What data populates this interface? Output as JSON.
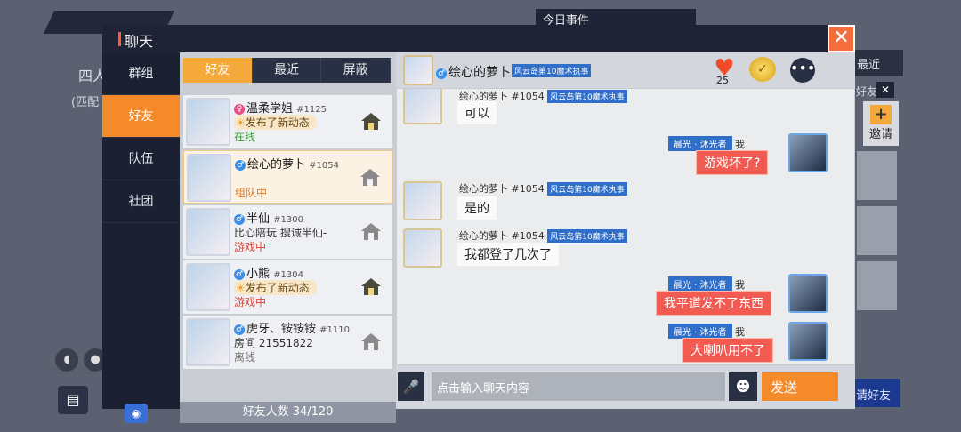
{
  "background": {
    "left_text": "四人",
    "left_sub": "(匹配",
    "event": "今日事件",
    "recent": "最近",
    "haoyou": "好友",
    "close": "✕",
    "invite": "邀请",
    "invite_plus": "+",
    "bottom_right": "请好友"
  },
  "dialog": {
    "title": "聊天",
    "close": "✕"
  },
  "sidebar": {
    "items": [
      {
        "label": "群组"
      },
      {
        "label": "好友"
      },
      {
        "label": "队伍"
      },
      {
        "label": "社团"
      }
    ]
  },
  "friends": {
    "tabs": [
      {
        "label": "好友"
      },
      {
        "label": "最近"
      },
      {
        "label": "屏蔽"
      }
    ],
    "list": [
      {
        "name": "温柔学姐",
        "num": "#1125",
        "gender": "♀",
        "sub": "发布了新动态",
        "status": "在线"
      },
      {
        "name": "绘心的萝卜",
        "num": "#1054",
        "gender": "♂",
        "sub": "",
        "status": "组队中"
      },
      {
        "name": "半仙",
        "num": "#1300",
        "gender": "♂",
        "sub": "比心陪玩 搜诚半仙-",
        "status": "游戏中"
      },
      {
        "name": "小熊",
        "num": "#1304",
        "gender": "♂",
        "sub": "发布了新动态",
        "status": "游戏中"
      },
      {
        "name": "虎牙、铵铵铵",
        "num": "#1110",
        "gender": "♂",
        "sub": "房间  21551822",
        "status": "离线"
      }
    ],
    "count": "好友人数 34/120"
  },
  "chat": {
    "header_name": "绘心的萝卜",
    "header_tag": "风云岛第10魔术执事",
    "heart_count": "25",
    "me_tag": "晨光 · 沐光者",
    "me_label": "我",
    "messages": [
      {
        "from": "other",
        "head": "绘心的萝卜 #1054",
        "tag": "风云岛第10魔术执事",
        "text": "可以"
      },
      {
        "from": "me",
        "text": "游戏坏了?"
      },
      {
        "from": "other",
        "head": "绘心的萝卜 #1054",
        "tag": "风云岛第10魔术执事",
        "text": "是的"
      },
      {
        "from": "other",
        "head": "绘心的萝卜 #1054",
        "tag": "风云岛第10魔术执事",
        "text": "我都登了几次了"
      },
      {
        "from": "me",
        "text": "我平道发不了东西"
      },
      {
        "from": "me",
        "text": "大喇叭用不了"
      }
    ],
    "input_placeholder": "点击输入聊天内容",
    "send": "发送"
  },
  "icons": {
    "more": "•••",
    "mic": "🎤",
    "emoji": "☻",
    "heart": "♥",
    "coin": "✓"
  },
  "colors": {
    "accent": "#f58a2b",
    "dark_panel": "#1b2133",
    "me_bubble": "#f15b52",
    "tag_blue": "#2f6ec9"
  }
}
